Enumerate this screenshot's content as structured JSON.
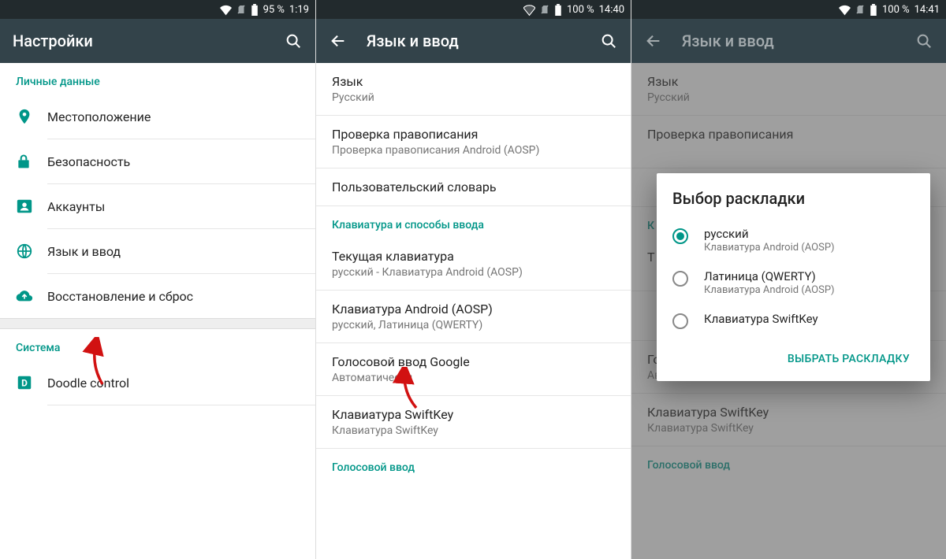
{
  "colors": {
    "accent": "#009688",
    "appbar": "#33434a",
    "arrow": "#d11111"
  },
  "screen1": {
    "status": {
      "battery": "95 %",
      "time": "1:19"
    },
    "title": "Настройки",
    "section_personal": "Личные данные",
    "items": {
      "location": "Местоположение",
      "security": "Безопасность",
      "accounts": "Аккаунты",
      "language": "Язык и ввод",
      "backup": "Восстановление и сброс"
    },
    "section_system": "Система",
    "doodle": "Doodle control"
  },
  "screen2": {
    "status": {
      "battery": "100 %",
      "time": "14:40"
    },
    "title": "Язык и ввод",
    "language": {
      "title": "Язык",
      "value": "Русский"
    },
    "spellcheck": {
      "title": "Проверка правописания",
      "value": "Проверка правописания Android (AOSP)"
    },
    "dictionary": "Пользовательский словарь",
    "section_keyboard": "Клавиатура и способы ввода",
    "current_kb": {
      "title": "Текущая клавиатура",
      "value": "русский - Клавиатура Android (AOSP)"
    },
    "aosp_kb": {
      "title": "Клавиатура Android (AOSP)",
      "value": "русский, Латиница (QWERTY)"
    },
    "google_voice": {
      "title": "Голосовой ввод Google",
      "value": "Автоматически"
    },
    "swiftkey": {
      "title": "Клавиатура SwiftKey",
      "value": "Клавиатура SwiftKey"
    },
    "section_voice": "Голосовой ввод"
  },
  "screen3": {
    "status": {
      "battery": "100 %",
      "time": "14:41"
    },
    "title": "Язык и ввод",
    "language": {
      "title": "Язык",
      "value": "Русский"
    },
    "spellcheck_title": "Проверка правописания",
    "section_keyboard_initial": "К",
    "current_kb_initial": "Т",
    "google_voice": {
      "title": "Голосовой ввод Google",
      "value": "Автоматически"
    },
    "swiftkey": {
      "title": "Клавиатура SwiftKey",
      "value": "Клавиатура SwiftKey"
    },
    "section_voice": "Голосовой ввод",
    "dialog": {
      "title": "Выбор раскладки",
      "options": [
        {
          "title": "русский",
          "sub": "Клавиатура Android (AOSP)",
          "selected": true
        },
        {
          "title": "Латиница (QWERTY)",
          "sub": "Клавиатура Android (AOSP)",
          "selected": false
        },
        {
          "title": "Клавиатура SwiftKey",
          "sub": "",
          "selected": false
        }
      ],
      "action": "ВЫБРАТЬ РАСКЛАДКУ"
    }
  }
}
